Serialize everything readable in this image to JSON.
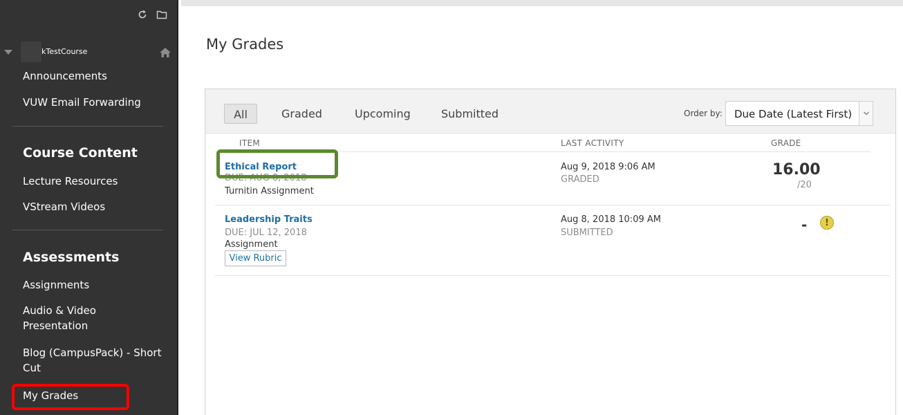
{
  "sidebar": {
    "course_name": "kTestCourse",
    "nav": {
      "announcements": "Announcements",
      "vuw_email": "VUW Email Forwarding",
      "course_content_heading": "Course Content",
      "lecture_resources": "Lecture Resources",
      "vstream_videos": "VStream Videos",
      "assessments_heading": "Assessments",
      "assignments": "Assignments",
      "audio_video_line1": "Audio & Video",
      "audio_video_line2": "Presentation",
      "blog_line1": "Blog (CampusPack) - Short",
      "blog_line2": "Cut",
      "my_grades": "My Grades"
    },
    "icons": {
      "refresh": "refresh-icon",
      "folder": "folder-icon",
      "home": "home-icon",
      "caret": "caret-down-icon"
    }
  },
  "main": {
    "title": "My Grades",
    "tabs": {
      "all": "All",
      "graded": "Graded",
      "upcoming": "Upcoming",
      "submitted": "Submitted"
    },
    "order_by_label": "Order by:",
    "order_by_value": "Due Date (Latest First)",
    "columns": {
      "item": "ITEM",
      "last_activity": "LAST ACTIVITY",
      "grade": "GRADE"
    },
    "rows": [
      {
        "title": "Ethical Report",
        "due": "DUE: AUG 8, 2018",
        "type": "Turnitin Assignment",
        "activity_date": "Aug 9, 2018 9:06 AM",
        "activity_status": "GRADED",
        "grade": "16.00",
        "grade_out_of": "/20"
      },
      {
        "title": "Leadership Traits",
        "due": "DUE: JUL 12, 2018",
        "type": "Assignment",
        "activity_date": "Aug 8, 2018 10:09 AM",
        "activity_status": "SUBMITTED",
        "grade": "-",
        "status_icon": "exclamation-icon",
        "rubric_button": "View Rubric"
      }
    ]
  },
  "colors": {
    "sidebar_bg": "#333333",
    "link": "#1d6fa5",
    "highlight_red": "#ff0000",
    "highlight_green": "#5b8a2e",
    "status_yellow": "#e3d04d"
  }
}
